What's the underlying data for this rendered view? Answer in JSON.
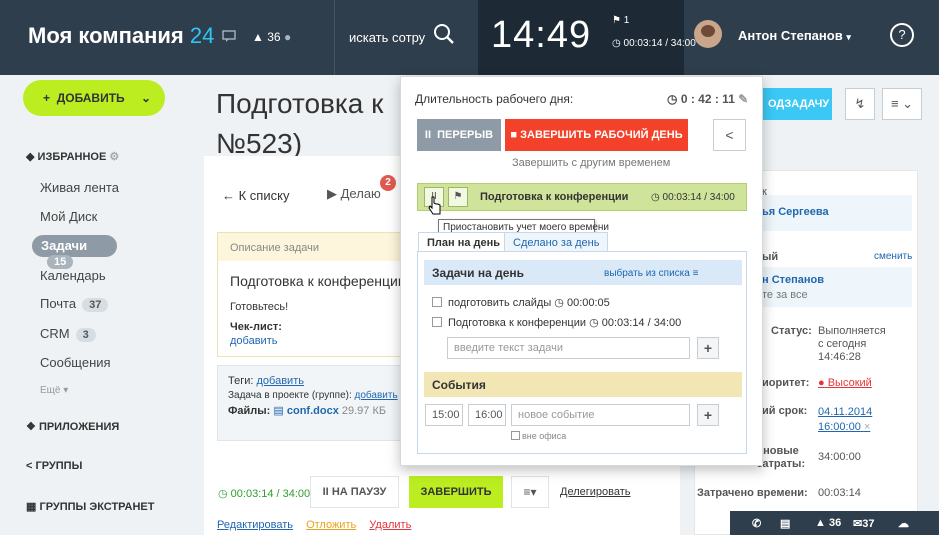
{
  "topbar": {
    "brand": "Моя компания",
    "brand_num": "24",
    "chat_icon": "chat-icon",
    "notifications": "36",
    "search_label": "искать сотру",
    "clock": "14:49",
    "clock_flag": "1",
    "clock_sub": "00:03:14 / 34:00",
    "user": "Антон Степанов",
    "help": "?"
  },
  "sidebar": {
    "add_button": "ДОБАВИТЬ",
    "favorites": "ИЗБРАННОЕ",
    "items": [
      {
        "label": "Живая лента"
      },
      {
        "label": "Мой Диск"
      },
      {
        "label": "Задачи",
        "count": "15"
      },
      {
        "label": "Календарь"
      },
      {
        "label": "Почта",
        "count": "37"
      },
      {
        "label": "CRM",
        "count": "3"
      },
      {
        "label": "Сообщения"
      },
      {
        "label": "Ещё"
      }
    ],
    "apps": "ПРИЛОЖЕНИЯ",
    "groups": "ГРУППЫ",
    "extranet": "ГРУППЫ ЭКСТРАНЕТ"
  },
  "task": {
    "title_line1": "Подготовка к",
    "title_line2": "№523)",
    "back": "К списку",
    "doing": "Делаю",
    "badge": "2",
    "desc_label": "Описание задачи",
    "desc_title": "Подготовка к конференции",
    "desc_note": "Готовьтесь!",
    "checklist": "Чек-лист:",
    "add": "добавить",
    "tags_label": "Теги:",
    "project_label": "Задача в проекте (группе):",
    "files_label": "Файлы:",
    "file_name": "conf.docx",
    "file_size": "29.97 КБ",
    "timer": "00:03:14 / 34:00",
    "pause_btn": "НА ПАУЗУ",
    "finish_btn": "ЗАВЕРШИТЬ",
    "delegate": "Делегировать",
    "edit": "Редактировать",
    "defer": "Отложить",
    "delete": "Удалить"
  },
  "header_right": {
    "subtask_btn": "ОДЗАДАЧУ"
  },
  "right_panel": {
    "creator": "ья Сергеева",
    "responsible_label": "ый",
    "change": "сменить",
    "responsible": "н Степанов",
    "responsible_sub": "те за все",
    "status_label": "Статус:",
    "status_value": "Выполняется",
    "status_since": "с сегодня",
    "status_time": "14:46:28",
    "priority_label": "иоритет:",
    "priority_value": "Высокий",
    "deadline_label": "ий срок:",
    "deadline_date": "04.11.2014",
    "deadline_time": "16:00:00",
    "planned_label1": "ановые",
    "planned_label2": "затраты:",
    "planned_value": "34:00:00",
    "spent_label": "Затрачено времени:",
    "spent_value": "00:03:14"
  },
  "popup": {
    "duration_label": "Длительность рабочего дня:",
    "duration_value": "0 : 42 : 11",
    "break_btn": "ПЕРЕРЫВ",
    "end_btn": "ЗАВЕРШИТЬ РАБОЧИЙ ДЕНЬ",
    "other_time": "Завершить с другим временем",
    "current_task": "Подготовка к конференции",
    "current_time": "00:03:14 / 34:00",
    "tooltip": "Приостановить учет моего времени",
    "tab_plan": "План на день",
    "tab_done": "Сделано за день",
    "tasks_head": "Задачи на день",
    "choose": "выбрать из списка",
    "task1": "подготовить слайды",
    "task1_time": "00:00:05",
    "task2": "Подготовка к конференции",
    "task2_time": "00:03:14 / 34:00",
    "task_placeholder": "введите текст задачи",
    "events_head": "События",
    "time_from": "15:00",
    "time_to": "16:00",
    "event_placeholder": "новое событие",
    "out_of_office": "вне офиса"
  },
  "statusbar": {
    "notifications": "36",
    "mail": "37"
  }
}
